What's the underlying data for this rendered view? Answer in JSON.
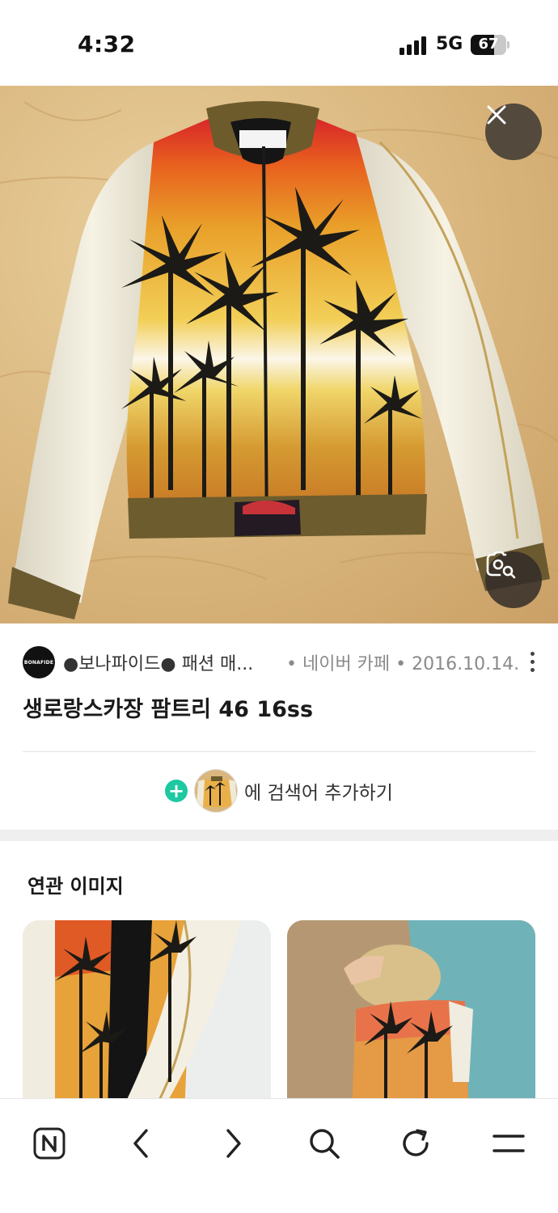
{
  "status_bar": {
    "time": "4:32",
    "network": "5G",
    "battery": "67",
    "battery_level": 0.67
  },
  "hero": {
    "close_icon": "close-icon",
    "lens_icon": "image-search-icon"
  },
  "source": {
    "logo_text": "BONAFIDE",
    "name": "●보나파이드● 패션 매...",
    "meta": "• 네이버 카페 • 2016.10.14."
  },
  "title": "생로랑스카장 팜트리 46 16ss",
  "add_search": {
    "text": "에 검색어 추가하기"
  },
  "related": {
    "title": "연관 이미지"
  },
  "nav": {
    "items": [
      "naver-home-icon",
      "back-icon",
      "forward-icon",
      "search-icon",
      "refresh-icon",
      "menu-icon"
    ]
  },
  "colors": {
    "accent_green": "#1ec8a0",
    "text_dark": "#1a1a1a",
    "muted": "#8a8a8a"
  }
}
